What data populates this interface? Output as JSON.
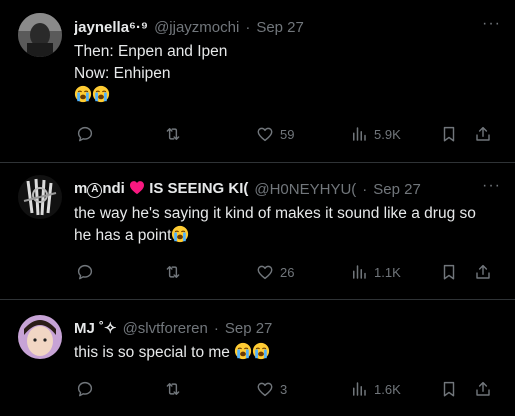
{
  "tweets": [
    {
      "display_name": "jaynella⁶·⁹",
      "handle": "@jjayzmochi",
      "sep": "·",
      "date": "Sep 27",
      "lines": [
        "Then: Enpen and Ipen",
        "Now: Enhipen"
      ],
      "actions": {
        "likes": "59",
        "views": "5.9K"
      }
    },
    {
      "display_name_parts": {
        "pre": "m",
        "circled": "A",
        "post": "ndi"
      },
      "display_name_suffix": "IS SEEING KI(",
      "handle": "@H0NEYHYU(",
      "sep": "·",
      "date": "Sep 27",
      "text": "the way he's saying it kind of makes it sound like a drug so he has a point",
      "actions": {
        "likes": "26",
        "views": "1.1K"
      }
    },
    {
      "display_name": "MJ ˚✧",
      "handle": "@slvtforeren",
      "sep": "·",
      "date": "Sep 27",
      "text": "this is so special to me ",
      "actions": {
        "likes": "3",
        "views": "1.6K"
      }
    }
  ],
  "icons": [
    "reply-icon",
    "retweet-icon",
    "like-icon",
    "views-icon",
    "bookmark-icon",
    "share-icon",
    "more-icon",
    "loudly-crying-emoji",
    "red-heart-emoji"
  ],
  "colors": {
    "background": "#000000",
    "text": "#e7e9ea",
    "muted": "#71767b",
    "divider": "#2f3336",
    "heart": "#f91880"
  }
}
